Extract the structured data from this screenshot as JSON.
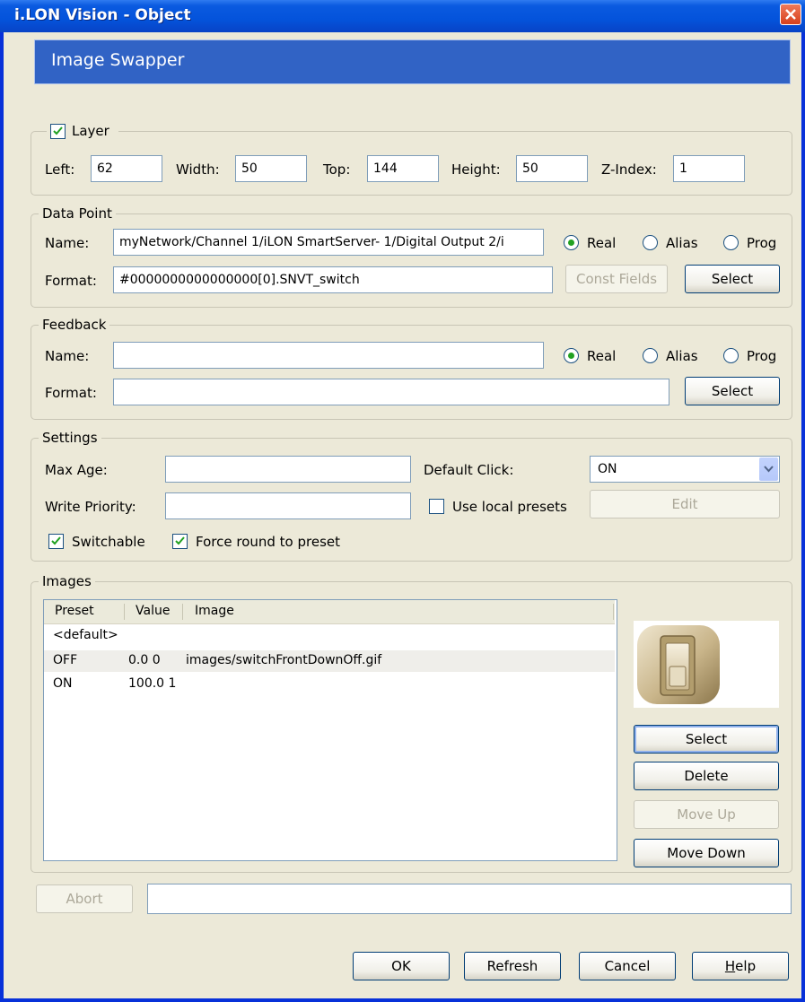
{
  "window": {
    "title": "i.LON Vision - Object"
  },
  "header": {
    "title": "Image Swapper"
  },
  "layer": {
    "label": "Layer",
    "checked": true,
    "left_label": "Left:",
    "left": "62",
    "width_label": "Width:",
    "width": "50",
    "top_label": "Top:",
    "top": "144",
    "height_label": "Height:",
    "height": "50",
    "zindex_label": "Z-Index:",
    "zindex": "1"
  },
  "data_point": {
    "legend": "Data Point",
    "name_label": "Name:",
    "name": "myNetwork/Channel 1/iLON SmartServer- 1/Digital Output 2/i",
    "format_label": "Format:",
    "format": "#0000000000000000[0].SNVT_switch",
    "radio_real": "Real",
    "radio_alias": "Alias",
    "radio_prog": "Prog",
    "selected": "Real",
    "const_fields": "Const Fields",
    "select": "Select"
  },
  "feedback": {
    "legend": "Feedback",
    "name_label": "Name:",
    "name": "",
    "format_label": "Format:",
    "format": "",
    "radio_real": "Real",
    "radio_alias": "Alias",
    "radio_prog": "Prog",
    "selected": "Real",
    "select": "Select"
  },
  "settings": {
    "legend": "Settings",
    "max_age_label": "Max Age:",
    "max_age": "",
    "write_priority_label": "Write Priority:",
    "write_priority": "",
    "default_click_label": "Default Click:",
    "default_click": "ON",
    "use_local_presets": "Use local presets",
    "use_local_presets_checked": false,
    "edit": "Edit",
    "switchable": "Switchable",
    "switchable_checked": true,
    "force_round": "Force round to preset",
    "force_round_checked": true
  },
  "images": {
    "legend": "Images",
    "columns": [
      "Preset",
      "Value",
      "Image"
    ],
    "rows": [
      {
        "preset": "<default>",
        "value": "",
        "image": ""
      },
      {
        "preset": "OFF",
        "value": "0.0 0",
        "image": "images/switchFrontDownOff.gif"
      },
      {
        "preset": "ON",
        "value": "100.0 1",
        "image": ""
      }
    ],
    "buttons": {
      "select": "Select",
      "delete": "Delete",
      "move_up": "Move Up",
      "move_down": "Move Down"
    }
  },
  "footer": {
    "abort": "Abort",
    "status": "",
    "ok": "OK",
    "refresh": "Refresh",
    "cancel": "Cancel",
    "help": "Help"
  }
}
